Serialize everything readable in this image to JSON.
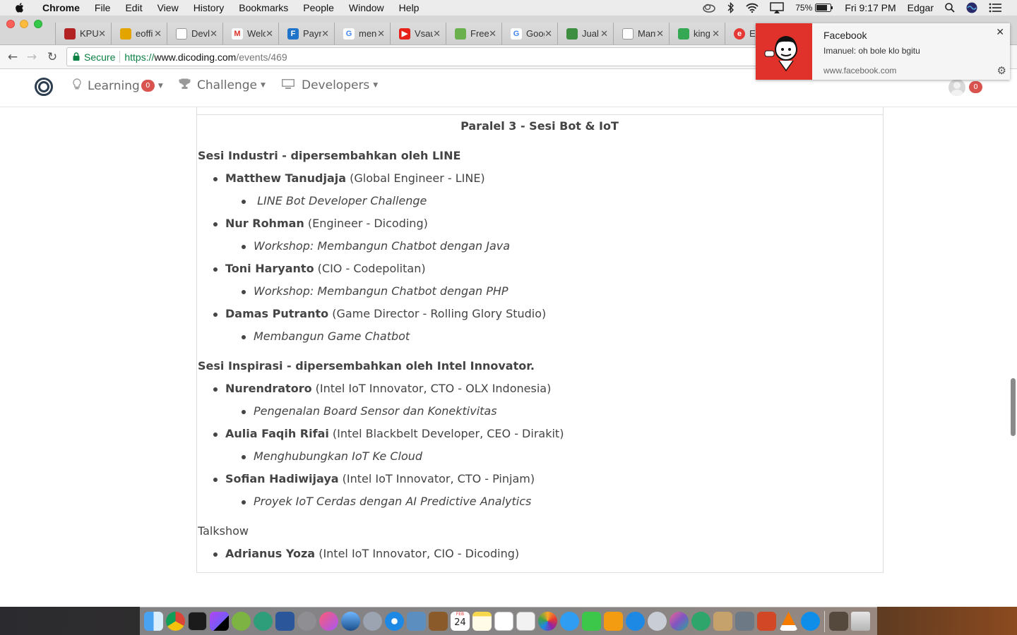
{
  "menubar": {
    "app_name": "Chrome",
    "items": [
      "File",
      "Edit",
      "View",
      "History",
      "Bookmarks",
      "People",
      "Window",
      "Help"
    ],
    "battery": "75%",
    "clock": "Fri 9:17 PM",
    "user": "Edgar"
  },
  "tabs": [
    {
      "label": "KPU",
      "color": "#b22222"
    },
    {
      "label": "eoffi",
      "color": "#e3a400"
    },
    {
      "label": "Devl",
      "color": "#9e9e9e"
    },
    {
      "label": "Welc",
      "color": "#d93025"
    },
    {
      "label": "Payr",
      "color": "#1f73c9"
    },
    {
      "label": "meng",
      "color": "#4285f4"
    },
    {
      "label": "Vsau",
      "color": "#e62117"
    },
    {
      "label": "Free",
      "color": "#6ab04c"
    },
    {
      "label": "Goog",
      "color": "#4285f4"
    },
    {
      "label": "Jual",
      "color": "#3e8e41"
    },
    {
      "label": "Mant",
      "color": "#9e9e9e"
    },
    {
      "label": "king",
      "color": "#34a853"
    },
    {
      "label": "E",
      "color": "#e53935"
    }
  ],
  "address_bar": {
    "secure_label": "Secure",
    "url_proto": "https://",
    "url_host": "www.dicoding.com",
    "url_path": "/events/469"
  },
  "site_nav": {
    "learning_label": "Learning",
    "learning_badge": "0",
    "challenge_label": "Challenge",
    "developers_label": "Developers",
    "user_badge": "0"
  },
  "content": {
    "session_title": "Paralel 3 - Sesi Bot & IoT",
    "industry_heading": "Sesi Industri - dipersembahkan oleh LINE",
    "industry_speakers": [
      {
        "name": "Matthew Tanudjaja",
        "role": " (Global Engineer - LINE)",
        "topic": " LINE Bot Developer Challenge"
      },
      {
        "name": "Nur Rohman",
        "role": " (Engineer - Dicoding)",
        "topic": "Workshop: Membangun Chatbot dengan Java"
      },
      {
        "name": "Toni Haryanto",
        "role": " (CIO - Codepolitan)",
        "topic": "Workshop: Membangun Chatbot dengan PHP"
      },
      {
        "name": "Damas Putranto",
        "role": " (Game Director - Rolling Glory Studio)",
        "topic": "Membangun Game Chatbot"
      }
    ],
    "inspiration_heading": "Sesi Inspirasi - dipersembahkan oleh Intel Innovator.",
    "inspiration_speakers": [
      {
        "name": "Nurendratoro",
        "role": " (Intel IoT Innovator, CTO - OLX Indonesia)",
        "topic": "Pengenalan Board Sensor dan Konektivitas"
      },
      {
        "name": "Aulia Faqih Rifai",
        "role": " (Intel Blackbelt Developer, CEO - Dirakit)",
        "topic": "Menghubungkan IoT Ke Cloud"
      },
      {
        "name": "Sofian Hadiwijaya",
        "role": " (Intel IoT Innovator, CTO - Pinjam)",
        "topic": "Proyek IoT Cerdas dengan AI Predictive Analytics"
      }
    ],
    "talkshow_heading": "Talkshow",
    "talkshow_speakers": [
      {
        "name": "Adrianus Yoza",
        "role": " (Intel IoT Innovator, CIO - Dicoding)"
      }
    ]
  },
  "notification": {
    "title": "Facebook",
    "message": "Imanuel: oh bole klo bgitu",
    "source": "www.facebook.com"
  },
  "dock": {
    "calendar_month": "FEB",
    "calendar_day": "24",
    "icons": [
      "finder-icon",
      "chrome-icon",
      "terminal-icon",
      "phpstorm-icon",
      "android-studio-icon",
      "atom-icon",
      "word-icon",
      "system-preferences-icon",
      "itunes-icon",
      "network-icon",
      "launchpad-icon",
      "safari-icon",
      "preview-icon",
      "notes-book-icon",
      "calendar-icon",
      "notes-icon",
      "reminders-icon",
      "pages-icon",
      "photos-icon",
      "messages-icon",
      "facetime-icon",
      "ibooks-icon",
      "app-store-icon",
      "utility-icon",
      "affinity-icon",
      "sourcetree-icon",
      "archive-utility-icon",
      "xcode-tools-icon",
      "powerpoint-icon",
      "vlc-icon",
      "teamviewer-icon",
      "downloads-stack-icon",
      "trash-icon"
    ]
  }
}
